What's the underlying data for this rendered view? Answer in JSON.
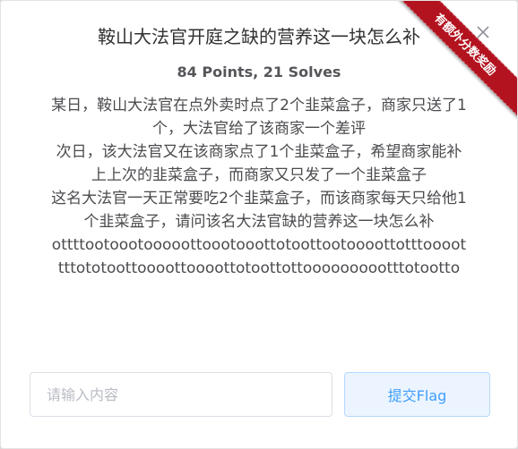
{
  "dialog": {
    "title": "鞍山大法官开庭之缺的营养这一块怎么补",
    "ribbon_label": "有额外分数奖励",
    "points_line": "84 Points, 21 Solves",
    "description": [
      "某日，鞍山大法官在点外卖时点了2个韭菜盒子，商家只送了1个，大法官给了该商家一个差评",
      "次日，该大法官又在该商家点了1个韭菜盒子，希望商家能补上上次的韭菜盒子，而商家又只发了一个韭菜盒子",
      "这名大法官一天正常要吃2个韭菜盒子，而该商家每天只给他1个韭菜盒子，请问该名大法官缺的营养这一块怎么补",
      "ottttootoootooooottoootooottotoottootoooottotttoooottttototoottoooottoooottotoottottoooooooootttotootto"
    ],
    "flag_placeholder": "请输入内容",
    "submit_label": "提交Flag"
  },
  "colors": {
    "ribbon": "#b3121f",
    "submit_text": "#409eff",
    "submit_bg": "#ecf5ff"
  }
}
